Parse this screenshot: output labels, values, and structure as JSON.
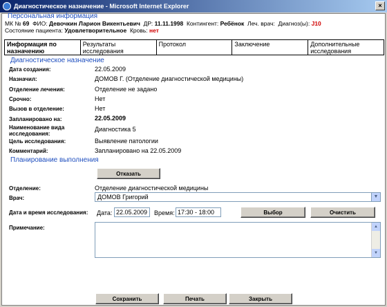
{
  "window": {
    "title": "Диагностическое назначение - Microsoft Internet Explorer",
    "close": "×"
  },
  "patient": {
    "section_title": "Персональная информация",
    "mk_label": "МК №",
    "mk_value": "69",
    "fio_label": "ФИО:",
    "fio_value": "Девочкин Ларион Викентьевич",
    "dob_label": "ДР:",
    "dob_value": "11.11.1998",
    "contingent_label": "Контингент:",
    "contingent_value": "Ребёнок",
    "doctor_label": "Леч. врач:",
    "diagnosis_label": "Диагноз(ы):",
    "diagnosis_value": "J10",
    "state_label": "Состояние пациента:",
    "state_value": "Удовлетворительное",
    "blood_label": "Кровь:",
    "blood_value": "нет"
  },
  "tabs": [
    {
      "label": "Информация по назначению"
    },
    {
      "label": "Результаты исследования"
    },
    {
      "label": "Протокол"
    },
    {
      "label": "Заключение"
    },
    {
      "label": "Дополнительные исследования"
    }
  ],
  "assignment": {
    "section_title": "Диагностическое назначение",
    "fields": [
      {
        "label": "Дата создания:",
        "value": "22.05.2009"
      },
      {
        "label": "Назначил:",
        "value": "ДОМОВ Г. (Отделение диагностической медицины)"
      },
      {
        "label": "Отделение лечения:",
        "value": "Отделение не задано"
      },
      {
        "label": "Срочно:",
        "value": "Нет"
      },
      {
        "label": "Вызов в отделение:",
        "value": "Нет"
      },
      {
        "label": "Запланировано на:",
        "value": "22.05.2009"
      },
      {
        "label": "Наименование вида исследования:",
        "value": "Диагностика 5"
      },
      {
        "label": "Цель исследования:",
        "value": "Выявление патологии"
      },
      {
        "label": "Комментарий:",
        "value": "Запланировано на 22.05.2009"
      }
    ]
  },
  "planning": {
    "section_title": "Планирование выполнения",
    "refuse_button": "Отказать",
    "department_label": "Отделение:",
    "department_value": "Отделение диагностической медицины",
    "doctor_label": "Врач:",
    "doctor_value": "ДОМОВ Григорий",
    "datetime_label": "Дата и время исследования:",
    "date_label": "Дата:",
    "date_value": "22.05.2009",
    "time_label": "Время:",
    "time_value": "17:30 - 18:00",
    "choose_button": "Выбор",
    "clear_button": "Очистить",
    "note_label": "Примечание:"
  },
  "footer": {
    "save": "Сохранить",
    "print": "Печать",
    "close": "Закрыть"
  }
}
